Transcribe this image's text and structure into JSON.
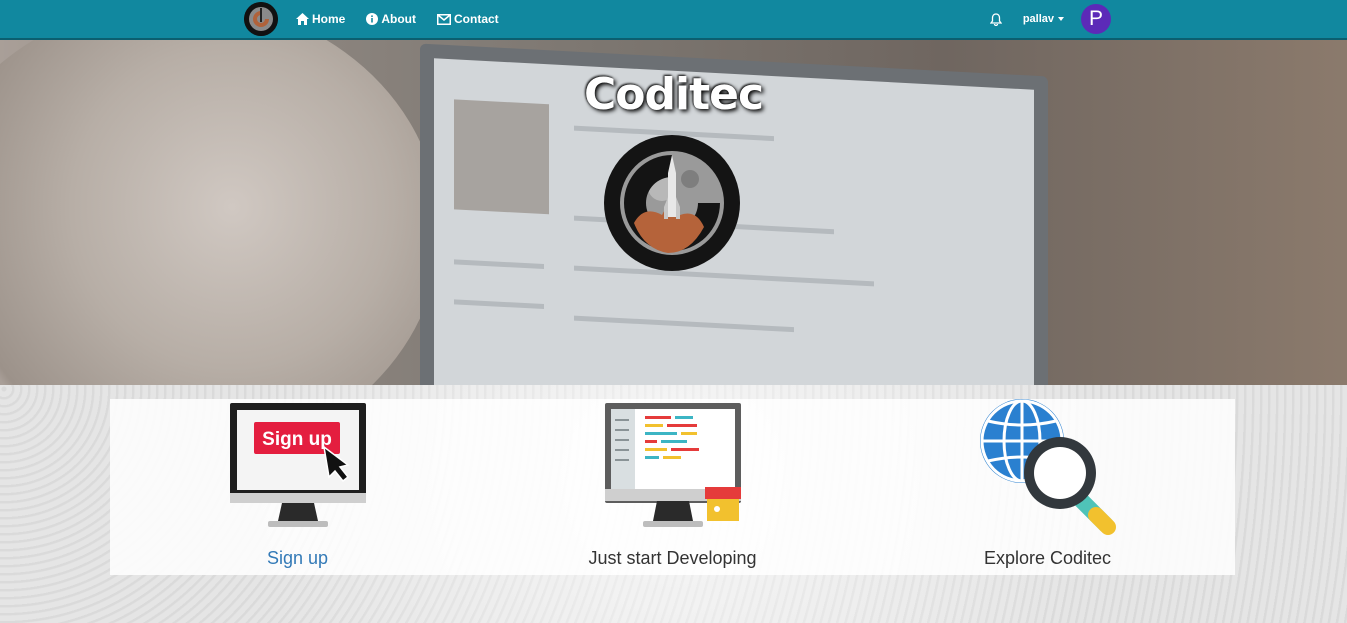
{
  "nav": {
    "brand_icon": "coditec-logo",
    "links": [
      {
        "label": "Home",
        "icon": "home-icon"
      },
      {
        "label": "About",
        "icon": "info-icon"
      },
      {
        "label": "Contact",
        "icon": "envelope-icon"
      }
    ],
    "username": "pallav",
    "avatar_letter": "P",
    "accent_color": "#11889f",
    "avatar_color": "#5c2ab8"
  },
  "hero": {
    "title": "Coditec"
  },
  "features": [
    {
      "label": "Sign up",
      "icon": "signup-monitor-icon",
      "badge_text": "Sign up"
    },
    {
      "label": "Just start Developing",
      "icon": "code-monitor-icon"
    },
    {
      "label": "Explore Coditec",
      "icon": "globe-search-icon"
    }
  ]
}
